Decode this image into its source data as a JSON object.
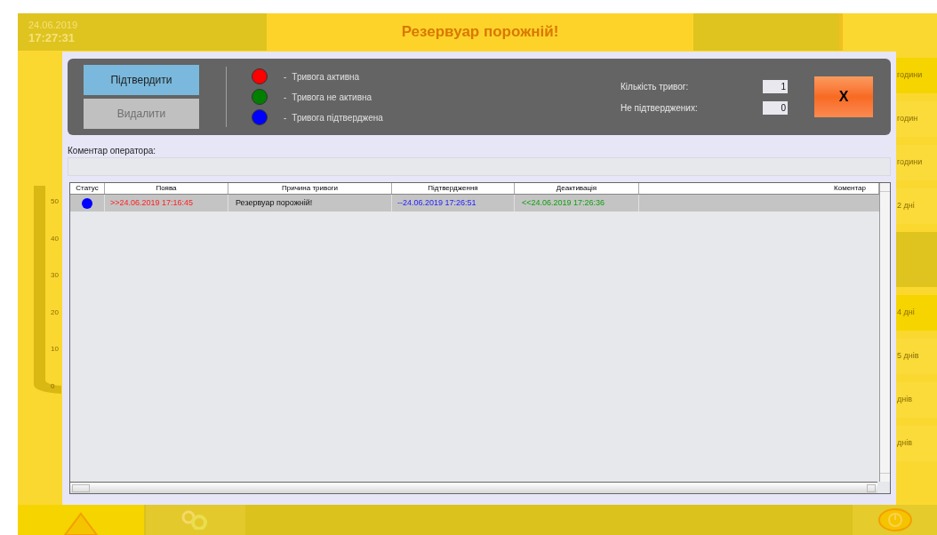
{
  "header": {
    "date": "24.06.2019",
    "time": "17:27:31",
    "message": "Резервуар порожній!"
  },
  "gauge": {
    "ticks": [
      "50",
      "40",
      "30",
      "20",
      "10",
      "0"
    ]
  },
  "side_items": [
    {
      "label": "години",
      "kind": "bright"
    },
    {
      "label": "годин",
      "kind": "plain"
    },
    {
      "label": "години",
      "kind": "plain"
    },
    {
      "label": "2 дні",
      "kind": "plain"
    },
    {
      "kind": "gap"
    },
    {
      "label": "4 дні",
      "kind": "bright"
    },
    {
      "label": "5 днів",
      "kind": "plain"
    },
    {
      "label": "днів",
      "kind": "plain"
    },
    {
      "label": "днів",
      "kind": "plain"
    }
  ],
  "dialog": {
    "buttons": [
      {
        "label": "Підтвердити",
        "disabled": false
      },
      {
        "label": "Видалити",
        "disabled": true
      }
    ],
    "legend": [
      {
        "color": "#ff0000",
        "dash": "-",
        "label": "Тривога активна"
      },
      {
        "color": "#008000",
        "dash": "-",
        "label": "Тривога не активна"
      },
      {
        "color": "#0000ff",
        "dash": "-",
        "label": "Тривога підтверджена"
      }
    ],
    "counters": [
      {
        "label": "Кількість тривог:",
        "value": "1"
      },
      {
        "label": "Не підтверджених:",
        "value": "0"
      }
    ],
    "close": "X",
    "comment_label": "Коментар оператора:",
    "table": {
      "columns": [
        "Статус",
        "Поява",
        "Причина тривоги",
        "Підтвердження",
        "Деактивація",
        "Коментар"
      ],
      "rows": [
        {
          "color": "#0000ff",
          "appeared": ">>24.06.2019 17:16:45",
          "cause": "Резервуар порожній!",
          "acknowledged": "--24.06.2019 17:26:51",
          "deactivated": "<<24.06.2019 17:26:36",
          "selected": true
        }
      ]
    }
  }
}
